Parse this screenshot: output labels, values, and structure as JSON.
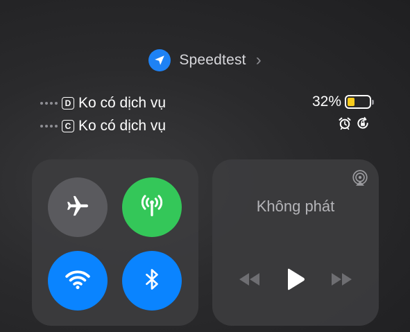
{
  "location_app": {
    "name": "Speedtest",
    "icon": "location-arrow-icon",
    "accent": "#1e82f5"
  },
  "carriers": [
    {
      "sim": "D",
      "status": "Ko có dịch vụ"
    },
    {
      "sim": "C",
      "status": "Ko có dịch vụ"
    }
  ],
  "battery": {
    "percent_label": "32%",
    "level": 0.32,
    "fill_color": "#f7cb1c"
  },
  "status_icons": [
    "alarm-clock-icon",
    "orientation-lock-icon"
  ],
  "connectivity": {
    "airplane": {
      "icon": "airplane-icon",
      "on": false,
      "color": "#5a5a5e"
    },
    "cellular": {
      "icon": "cellular-antenna-icon",
      "on": true,
      "color": "#34c759"
    },
    "wifi": {
      "icon": "wifi-icon",
      "on": true,
      "color": "#0a84ff"
    },
    "bluetooth": {
      "icon": "bluetooth-icon",
      "on": true,
      "color": "#0a84ff"
    }
  },
  "media": {
    "now_playing": "Không phát",
    "icons": [
      "airplay-icon",
      "rewind-icon",
      "play-icon",
      "fast-forward-icon"
    ]
  }
}
